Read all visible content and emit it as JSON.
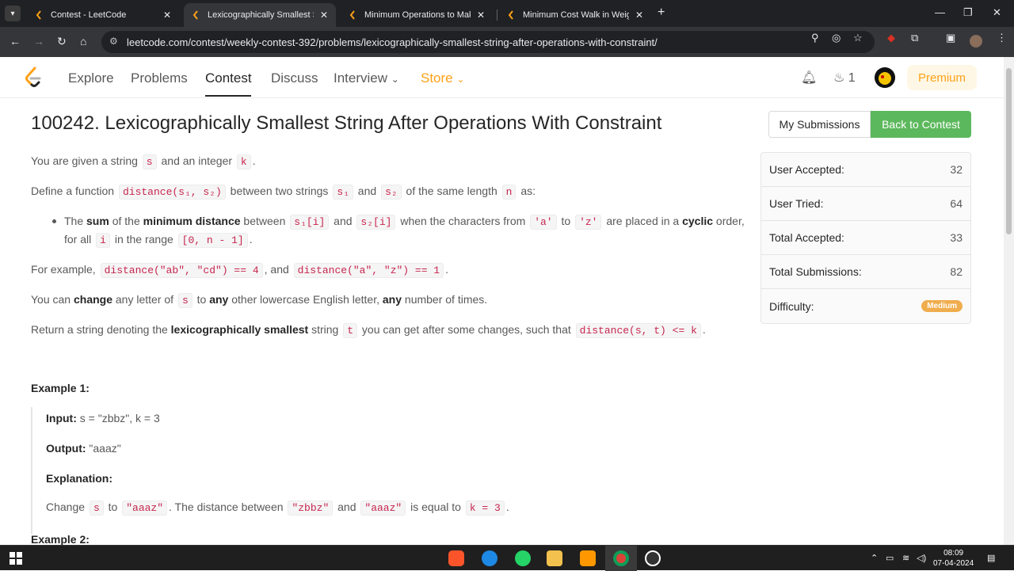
{
  "browser": {
    "tabs": [
      {
        "title": "Contest - LeetCode",
        "active": false
      },
      {
        "title": "Lexicographically Smallest Strin",
        "active": true
      },
      {
        "title": "Minimum Operations to Make t",
        "active": false
      },
      {
        "title": "Minimum Cost Walk in Weighte",
        "active": false
      }
    ],
    "url": "leetcode.com/contest/weekly-contest-392/problems/lexicographically-smallest-string-after-operations-with-constraint/"
  },
  "nav": {
    "links": [
      "Explore",
      "Problems",
      "Contest",
      "Discuss",
      "Interview",
      "Store"
    ],
    "streak_count": "1",
    "premium_label": "Premium"
  },
  "problem": {
    "title": "100242. Lexicographically Smallest String After Operations With Constraint",
    "p1": {
      "a": "You are given a string ",
      "c1": "s",
      "b": " and an integer ",
      "c2": "k",
      "c": "."
    },
    "p2": {
      "a": "Define a function ",
      "c1": "distance(s₁, s₂)",
      "b": " between two strings ",
      "c2": "s₁",
      "c": " and ",
      "c3": "s₂",
      "d": " of the same length ",
      "c4": "n",
      "e": " as:"
    },
    "bullet": {
      "a": "The ",
      "b1": "sum",
      "b": " of the ",
      "b2": "minimum distance",
      "c": " between ",
      "c1": "s₁[i]",
      "d": " and ",
      "c2": "s₂[i]",
      "e": " when the characters from ",
      "c3": "'a'",
      "f": " to ",
      "c4": "'z'",
      "g": " are placed in a ",
      "b3": "cyclic",
      "h": " order,",
      "line2a": "for all ",
      "c5": "i",
      "line2b": " in the range ",
      "c6": "[0, n - 1]",
      "line2c": "."
    },
    "p3": {
      "a": "For example, ",
      "c1": "distance(\"ab\", \"cd\") == 4",
      "b": ", and ",
      "c2": "distance(\"a\", \"z\") == 1",
      "c": "."
    },
    "p4": {
      "a": "You can ",
      "b1": "change",
      "b": " any letter of ",
      "c1": "s",
      "c": " to ",
      "b2": "any",
      "d": " other lowercase English letter, ",
      "b3": "any",
      "e": " number of times."
    },
    "p5": {
      "a": "Return a string denoting the ",
      "b1": "lexicographically smallest",
      "b": " string ",
      "c1": "t",
      "c": " you can get after some changes, such that ",
      "c2": "distance(s, t) <= k",
      "d": "."
    },
    "example1": {
      "heading": "Example 1:",
      "input_label": "Input:",
      "input": " s = \"zbbz\", k = 3",
      "output_label": "Output:",
      "output": " \"aaaz\"",
      "explanation_label": "Explanation:",
      "exp": {
        "a": "Change ",
        "c1": "s",
        "b": " to ",
        "c2": "\"aaaz\"",
        "c": ". The distance between ",
        "c3": "\"zbbz\"",
        "d": " and ",
        "c4": "\"aaaz\"",
        "e": " is equal to ",
        "c5": "k = 3",
        "f": "."
      }
    },
    "example2_heading": "Example 2:"
  },
  "sidebar": {
    "my_submissions": "My Submissions",
    "back_to_contest": "Back to Contest",
    "stats": [
      {
        "label": "User Accepted:",
        "value": "32"
      },
      {
        "label": "User Tried:",
        "value": "64"
      },
      {
        "label": "Total Accepted:",
        "value": "33"
      },
      {
        "label": "Total Submissions:",
        "value": "82"
      },
      {
        "label": "Difficulty:",
        "value": "Medium"
      }
    ]
  },
  "taskbar": {
    "time": "08:09",
    "date": "07-04-2024"
  },
  "colors": {
    "accent": "#ffa116",
    "back_button": "#5cb85c",
    "difficulty_badge": "#f0ad4e",
    "code": "#c7254e"
  }
}
